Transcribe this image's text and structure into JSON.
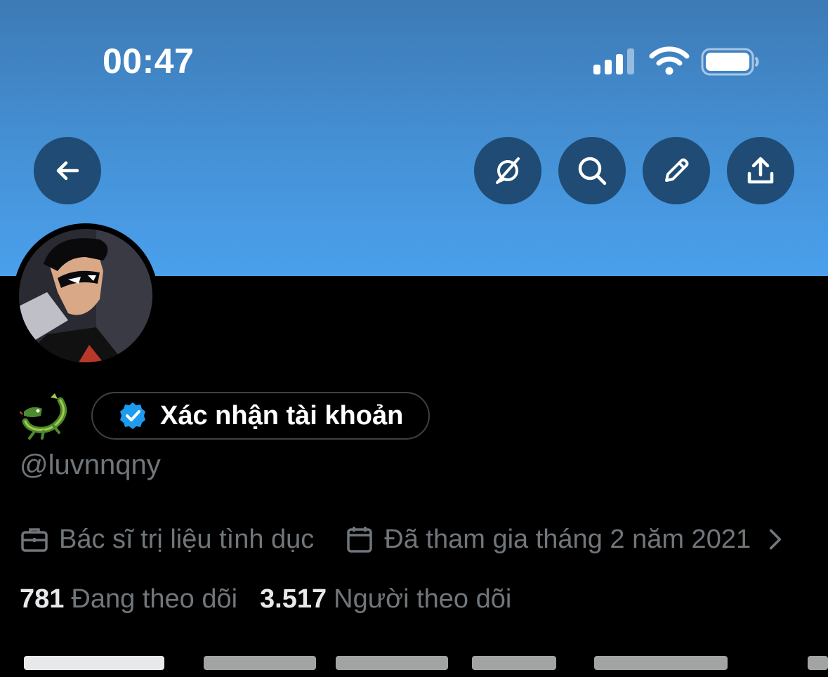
{
  "status_bar": {
    "time": "00:47"
  },
  "profile": {
    "verify_label": "Xác nhận tài khoản",
    "handle": "@luvnnqny",
    "profession": "Bác sĩ trị liệu tình dục",
    "joined": "Đã tham gia tháng 2 năm 2021",
    "following_count": "781",
    "following_label": "Đang theo dõi",
    "followers_count": "3.517",
    "followers_label": "Người theo dõi"
  },
  "icons": {
    "back": "back-arrow-icon",
    "grok": "grok-icon",
    "search": "search-icon",
    "edit": "pencil-icon",
    "share": "share-icon",
    "verified": "verified-badge-icon",
    "profession": "briefcase-icon",
    "joined": "calendar-icon"
  },
  "colors": {
    "banner_top": "#3d7ab5",
    "banner_bottom": "#4aa0ec",
    "round_button": "#1f4b74",
    "verified_blue": "#1d9bf0",
    "muted_text": "#71767b"
  }
}
